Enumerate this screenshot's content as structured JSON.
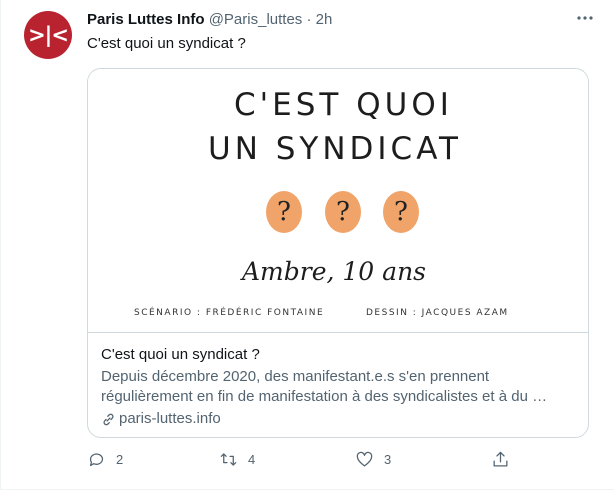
{
  "author": {
    "name": "Paris Luttes Info",
    "handle": "@Paris_luttes",
    "separator": "·",
    "time": "2h",
    "avatar_glyph": ">|<"
  },
  "tweet": {
    "text": "C'est quoi un syndicat ?"
  },
  "card": {
    "image": {
      "line1": "C'EST QUOI",
      "line2": "UN SYNDICAT",
      "question_marks": [
        "?",
        "?",
        "?"
      ],
      "byline": "Ambre, 10 ans",
      "credit_left": "SCÉNARIO : FRÉDÉRIC FONTAINE",
      "credit_right": "DESSIN : JACQUES AZAM"
    },
    "title": "C'est quoi un syndicat ?",
    "description": "Depuis décembre 2020, des manifestant.e.s s'en prennent régulièrement en fin de manifestation à des syndicalistes et à du …",
    "link": "paris-luttes.info"
  },
  "actions": {
    "reply_count": "2",
    "retweet_count": "4",
    "like_count": "3"
  },
  "colors": {
    "avatar_bg": "#b8232f",
    "bubble": "#f0a46a",
    "secondary_text": "#536471"
  }
}
